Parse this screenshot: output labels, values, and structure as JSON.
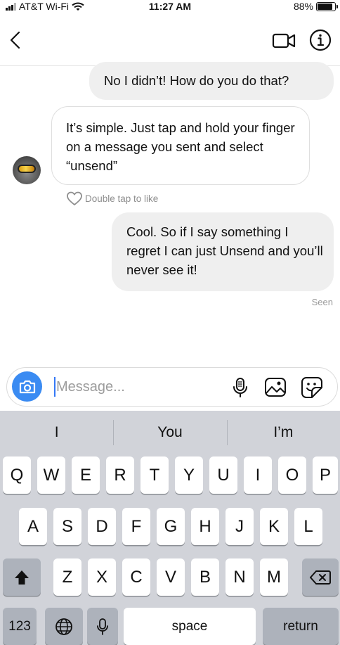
{
  "status_bar": {
    "carrier": "AT&T Wi-Fi",
    "time": "11:27 AM",
    "battery": "88%",
    "battery_level": 0.88
  },
  "nav": {
    "back_icon": "chevron-left-icon",
    "video_icon": "video-camera-icon",
    "info_icon": "info-icon"
  },
  "messages": [
    {
      "direction": "outgoing",
      "text": "No I didn’t! How do you do that?"
    },
    {
      "direction": "incoming",
      "text": "It’s simple. Just tap and hold your finger on a message you sent and select “unsend”"
    },
    {
      "direction": "outgoing",
      "text": "Cool. So if I say something I regret I can just Unsend and you’ll never see it!"
    }
  ],
  "like_hint": "Double tap to like",
  "seen_label": "Seen",
  "composer": {
    "placeholder": "Message...",
    "value": ""
  },
  "keyboard": {
    "suggestions": [
      "I",
      "You",
      "I’m"
    ],
    "row1": [
      "Q",
      "W",
      "E",
      "R",
      "T",
      "Y",
      "U",
      "I",
      "O",
      "P"
    ],
    "row2": [
      "A",
      "S",
      "D",
      "F",
      "G",
      "H",
      "J",
      "K",
      "L"
    ],
    "row3": [
      "Z",
      "X",
      "C",
      "V",
      "B",
      "N",
      "M"
    ],
    "numbers_label": "123",
    "space_label": "space",
    "return_label": "return"
  },
  "colors": {
    "accent": "#3a8bf2",
    "outgoing_bubble": "#efefef",
    "keyboard_bg": "#d1d3d9",
    "function_key": "#adb2bb"
  }
}
